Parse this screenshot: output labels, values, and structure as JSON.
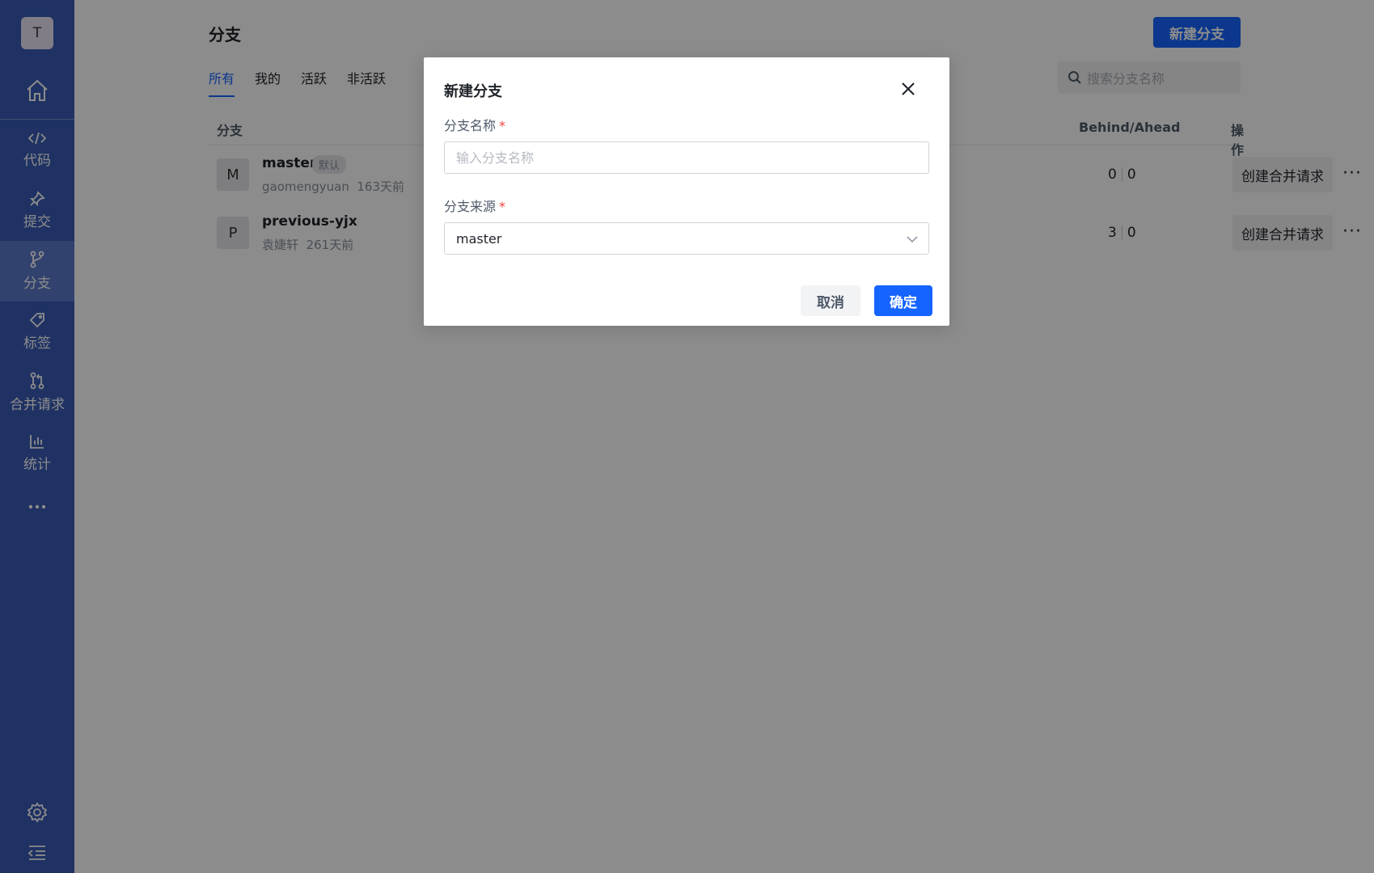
{
  "sidebar": {
    "avatar_letter": "T",
    "items": [
      {
        "label": "代码",
        "icon": "code-icon"
      },
      {
        "label": "提交",
        "icon": "pin-icon"
      },
      {
        "label": "分支",
        "icon": "branch-icon",
        "active": true
      },
      {
        "label": "标签",
        "icon": "tag-icon"
      },
      {
        "label": "合并请求",
        "icon": "merge-request-icon"
      },
      {
        "label": "统计",
        "icon": "bar-chart-icon"
      }
    ]
  },
  "header": {
    "title": "分支",
    "new_branch_button": "新建分支",
    "search_placeholder": "搜索分支名称"
  },
  "tabs": [
    "所有",
    "我的",
    "活跃",
    "非活跃"
  ],
  "table": {
    "columns": {
      "branch": "分支",
      "behind_ahead": "Behind/Ahead",
      "actions": "操作"
    },
    "rows": [
      {
        "avatar": "M",
        "name": "master",
        "badge": "默认",
        "author": "gaomengyuan",
        "time": "163天前",
        "behind": "0",
        "ahead": "0",
        "action": "创建合并请求"
      },
      {
        "avatar": "P",
        "name": "previous-yjx",
        "author": "袁婕轩",
        "time": "261天前",
        "behind": "3",
        "ahead": "0",
        "action": "创建合并请求"
      }
    ]
  },
  "modal": {
    "title": "新建分支",
    "name_label": "分支名称",
    "name_placeholder": "输入分支名称",
    "source_label": "分支来源",
    "source_value": "master",
    "required_mark": "*",
    "cancel": "取消",
    "confirm": "确定"
  },
  "colors": {
    "sidebar": "#3a5bb5",
    "primary": "#1664ff",
    "required": "#f53f3f"
  }
}
